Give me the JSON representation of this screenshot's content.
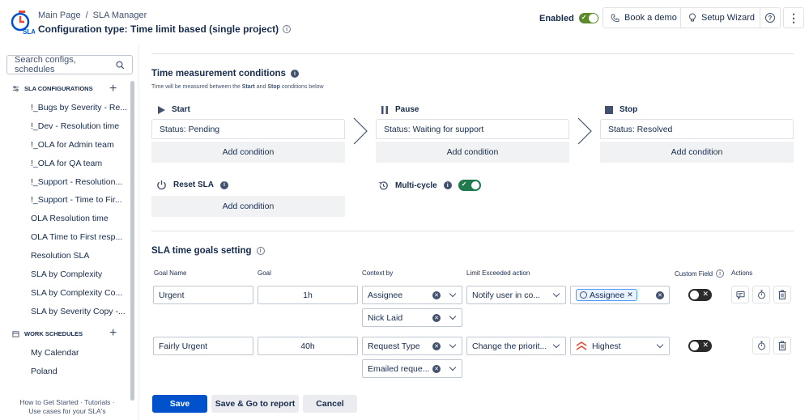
{
  "header": {
    "breadcrumb": [
      "Main Page",
      "/",
      "SLA Manager"
    ],
    "title": "Configuration type: Time limit based (single project)",
    "enabled_label": "Enabled",
    "book_demo": "Book a demo",
    "setup_wizard": "Setup Wizard"
  },
  "sidebar": {
    "search_placeholder": "Search configs, schedules",
    "configs_title": "SLA CONFIGURATIONS",
    "configs": [
      "!_Bugs by Severity - Re...",
      "!_Dev - Resolution time",
      "!_OLA for Admin team",
      "!_OLA for QA team",
      "!_Support - Resolution...",
      "!_Support - Time to Fir...",
      "OLA Resolution time",
      "OLA Time to First resp...",
      "Resolution SLA",
      "SLA by Complexity",
      "SLA by Complexity Co...",
      "SLA by Severity Copy -..."
    ],
    "schedules_title": "WORK SCHEDULES",
    "schedules": [
      "My Calendar",
      "Poland"
    ],
    "footer_line1": "How to Get Started  ·  Tutorials  ·",
    "footer_line2": "Use cases for your SLA's"
  },
  "measurement": {
    "title": "Time measurement conditions",
    "subtitle_parts": [
      "Time will be measured between the ",
      "Start",
      " and ",
      "Stop",
      " conditions below"
    ],
    "start": {
      "label": "Start",
      "condition": "Status: Pending",
      "add": "Add condition"
    },
    "pause": {
      "label": "Pause",
      "condition": "Status: Waiting for support",
      "add": "Add condition"
    },
    "stop": {
      "label": "Stop",
      "condition": "Status: Resolved",
      "add": "Add condition"
    },
    "reset": {
      "label": "Reset SLA",
      "add": "Add condition"
    },
    "multicycle": {
      "label": "Multi-cycle",
      "enabled": true
    }
  },
  "goals": {
    "title": "SLA time goals setting",
    "columns": {
      "goal_name": "Goal Name",
      "goal": "Goal",
      "context": "Context by",
      "limit": "Limit Exceeded action",
      "custom_field": "Custom Field",
      "actions": "Actions"
    },
    "rows": [
      {
        "name": "Urgent",
        "goal": "1h",
        "context": [
          "Assignee",
          "Nick Laid"
        ],
        "action": "Notify user in co...",
        "action_value": "Assignee",
        "custom_field": false
      },
      {
        "name": "Fairly Urgent",
        "goal": "40h",
        "context": [
          "Request Type",
          "Emailed reque..."
        ],
        "action": "Change the priorit...",
        "action_value": "Highest",
        "custom_field": false
      }
    ]
  },
  "buttons": {
    "save": "Save",
    "save_report": "Save & Go to report",
    "cancel": "Cancel"
  },
  "colors": {
    "primary": "#0052cc",
    "toggle_enabled": "#5a8a2a",
    "toggle_multicycle": "#1f7a4d",
    "priority_highest": "#e5493a"
  }
}
